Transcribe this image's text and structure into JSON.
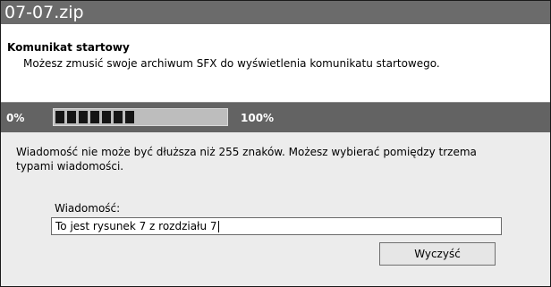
{
  "window": {
    "title": "07-07.zip"
  },
  "header": {
    "title": "Komunikat startowy",
    "description": "Możesz zmusić swoje archiwum SFX do wyświetlenia komunikatu startowego."
  },
  "progress": {
    "start_label": "0%",
    "end_label": "100%",
    "filled_segments": 7,
    "fraction": 0.42
  },
  "content": {
    "info": "Wiadomość nie może być dłuższa niż 255 znaków. Możesz wybierać pomiędzy trzema typami wiadomości.",
    "message_label": "Wiadomość:",
    "message_value": "To jest rysunek 7 z rozdziału 7",
    "clear_button": "Wyczyść"
  }
}
